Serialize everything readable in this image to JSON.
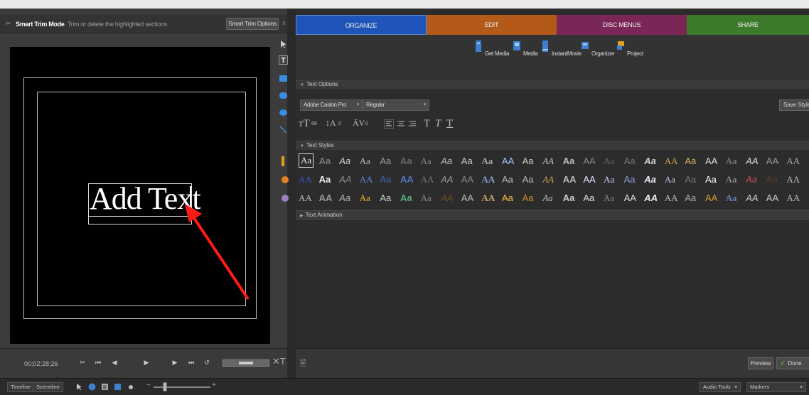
{
  "monitor": {
    "mode_label": "Smart Trim Mode",
    "mode_hint": ". Trim or delete the highlighted sections",
    "smart_trim_options": "Smart Trim Options",
    "close": "x",
    "overlay_text": "Add Text",
    "timecode": "00;02;28;26"
  },
  "tabs": {
    "organize": "ORGANIZE",
    "edit": "EDIT",
    "disc_menus": "DISC MENUS",
    "share": "SHARE"
  },
  "mainbar": {
    "get_media": "Get Media",
    "media": "Media",
    "instantmovie": "InstantMovie",
    "organizer": "Organizer",
    "project": "Project"
  },
  "text_options": {
    "header": "Text Options",
    "font": "Adobe Caslon Pro",
    "style": "Regular",
    "save_style": "Save Style",
    "size_value": "68",
    "leading_value": "0",
    "kerning_value": "0"
  },
  "text_styles": {
    "header": "Text Styles",
    "row1": [
      {
        "t": "Aa",
        "c": "#e6e6e6"
      },
      {
        "t": "Aa",
        "c": "#777"
      },
      {
        "t": "Aa",
        "c": "#ccc"
      },
      {
        "t": "Aa",
        "c": "#bbb"
      },
      {
        "t": "Aa",
        "c": "#999"
      },
      {
        "t": "Aa",
        "c": "#666"
      },
      {
        "t": "Aa",
        "c": "#888"
      },
      {
        "t": "Aa",
        "c": "#bbb"
      },
      {
        "t": "Aa",
        "c": "#ccc"
      },
      {
        "t": "Aa",
        "c": "#aaa"
      },
      {
        "t": "AA",
        "c": "#9fc7ff"
      },
      {
        "t": "Aa",
        "c": "#ccc"
      },
      {
        "t": "AA",
        "c": "#bbb"
      },
      {
        "t": "Aa",
        "c": "#bbb"
      },
      {
        "t": "AA",
        "c": "#888"
      },
      {
        "t": "Aa",
        "c": "#666"
      },
      {
        "t": "Aa",
        "c": "#777"
      },
      {
        "t": "Aa",
        "c": "#ccc"
      },
      {
        "t": "AA",
        "c": "#caa54a"
      },
      {
        "t": "Aa",
        "c": "#d6b463"
      },
      {
        "t": "AA",
        "c": "#ddd"
      },
      {
        "t": "Aa",
        "c": "#777"
      },
      {
        "t": "AA",
        "c": "#ddd"
      },
      {
        "t": "AA",
        "c": "#999"
      },
      {
        "t": "AA",
        "c": "#aaa"
      }
    ],
    "row2": [
      {
        "t": "AA",
        "c": "#3a57c8"
      },
      {
        "t": "Aa",
        "c": "#f0f0f0"
      },
      {
        "t": "AA",
        "c": "#888"
      },
      {
        "t": "AA",
        "c": "#5a8bd6"
      },
      {
        "t": "Aa",
        "c": "#3a66b0"
      },
      {
        "t": "AA",
        "c": "#4f77c8"
      },
      {
        "t": "AA",
        "c": "#777"
      },
      {
        "t": "AA",
        "c": "#999"
      },
      {
        "t": "AA",
        "c": "#888"
      },
      {
        "t": "AA",
        "c": "#8aa3d6"
      },
      {
        "t": "Aa",
        "c": "#bbb"
      },
      {
        "t": "Aa",
        "c": "#bbb"
      },
      {
        "t": "AA",
        "c": "#caa54a"
      },
      {
        "t": "AA",
        "c": "#bbb"
      },
      {
        "t": "AA",
        "c": "#dfe9ff"
      },
      {
        "t": "Aa",
        "c": "#c9d7f0"
      },
      {
        "t": "Aa",
        "c": "#8aa3d6"
      },
      {
        "t": "Aa",
        "c": "#e8eef8"
      },
      {
        "t": "Aa",
        "c": "#b8c6e0"
      },
      {
        "t": "Aa",
        "c": "#777"
      },
      {
        "t": "Aa",
        "c": "#ffffff"
      },
      {
        "t": "Aa",
        "c": "#888"
      },
      {
        "t": "Aa",
        "c": "#c05050"
      },
      {
        "t": "Aa",
        "c": "#554422"
      },
      {
        "t": "AA",
        "c": "#bbb"
      }
    ],
    "row3": [
      {
        "t": "AA",
        "c": "#bbb"
      },
      {
        "t": "AA",
        "c": "#999"
      },
      {
        "t": "Aa",
        "c": "#aaa"
      },
      {
        "t": "Aa",
        "c": "#f2b320"
      },
      {
        "t": "Aa",
        "c": "#ccc"
      },
      {
        "t": "Aa",
        "c": "#4fb07a"
      },
      {
        "t": "Aa",
        "c": "#888"
      },
      {
        "t": "AA",
        "c": "#6a5020"
      },
      {
        "t": "AA",
        "c": "#bbb"
      },
      {
        "t": "AA",
        "c": "#c9a560"
      },
      {
        "t": "Aa",
        "c": "#f5c040"
      },
      {
        "t": "Aa",
        "c": "#d08a30"
      },
      {
        "t": "Aa",
        "c": "#bbb"
      },
      {
        "t": "Aa",
        "c": "#ccc"
      },
      {
        "t": "Aa",
        "c": "#ddd"
      },
      {
        "t": "Aa",
        "c": "#888"
      },
      {
        "t": "AA",
        "c": "#ddd"
      },
      {
        "t": "AA",
        "c": "#eee"
      },
      {
        "t": "AA",
        "c": "#bbb"
      },
      {
        "t": "Aa",
        "c": "#aaa"
      },
      {
        "t": "AA",
        "c": "#d99a30"
      },
      {
        "t": "Aa",
        "c": "#6a7fb0"
      },
      {
        "t": "AA",
        "c": "#ccc"
      },
      {
        "t": "AA",
        "c": "#ccc"
      },
      {
        "t": "AA",
        "c": "#bbb"
      }
    ]
  },
  "text_animation": {
    "header": "Text Animation"
  },
  "bottom": {
    "preview": "Preview",
    "done": "Done"
  },
  "timeline": {
    "timeline_tab": "Timeline",
    "sceneline_tab": "Sceneline",
    "audio_tools": "Audio Tools",
    "markers": "Markers",
    "zoom_level": 0.2
  },
  "colors": {
    "organize": "#1f55b8",
    "edit": "#b3591a",
    "disc_menus": "#7a2656",
    "share": "#3c7a2c",
    "annotation_arrow": "#ff1a1a"
  }
}
